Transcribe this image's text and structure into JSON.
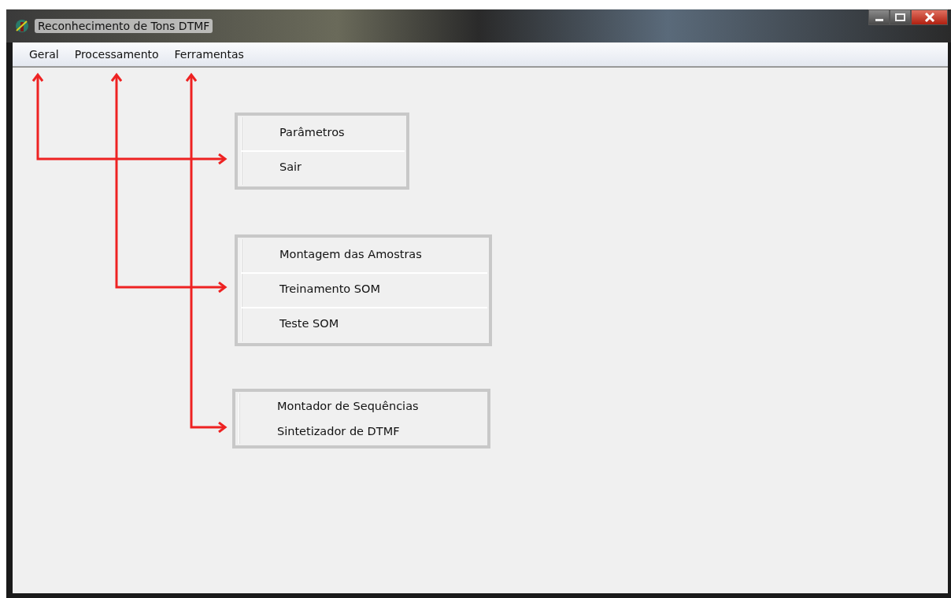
{
  "window": {
    "title": "Reconhecimento de Tons DTMF"
  },
  "menu_bar": [
    {
      "label": "Geral"
    },
    {
      "label": "Processamento"
    },
    {
      "label": "Ferramentas"
    }
  ],
  "menus": [
    {
      "divided": true,
      "items": [
        "Parâmetros",
        "Sair"
      ]
    },
    {
      "divided": true,
      "items": [
        "Montagem das Amostras",
        "Treinamento SOM",
        "Teste SOM"
      ]
    },
    {
      "divided": false,
      "items": [
        "Montador de Sequências",
        "Sintetizador de DTMF"
      ]
    }
  ]
}
